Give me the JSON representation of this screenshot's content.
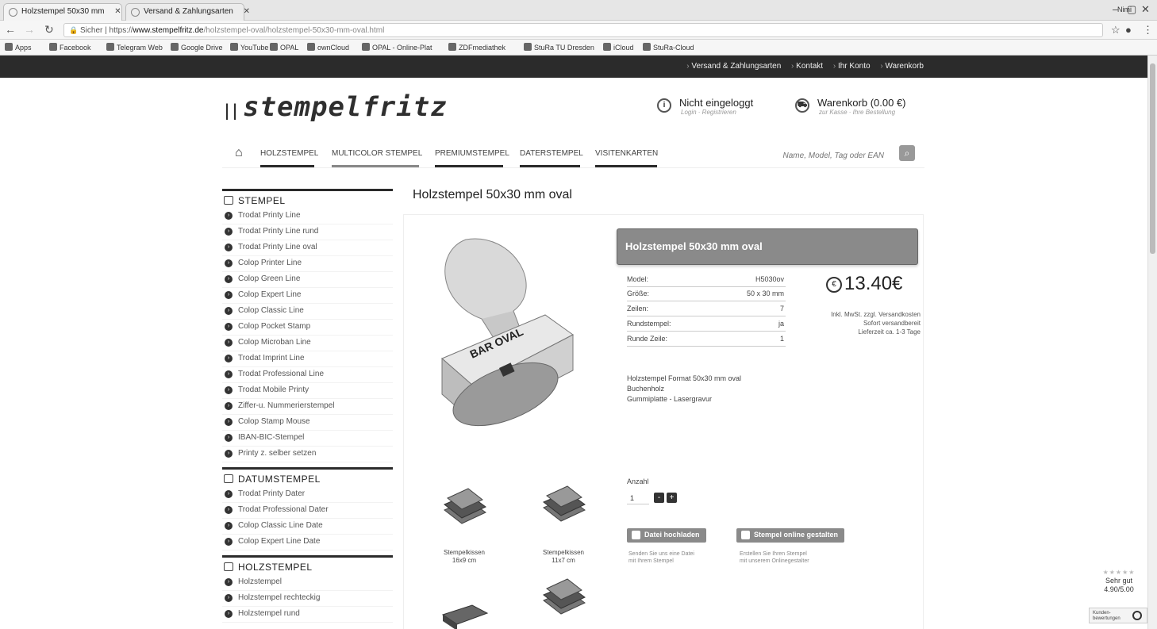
{
  "browser": {
    "tabs": [
      {
        "label": "Holzstempel 50x30 mm"
      },
      {
        "label": "Versand & Zahlungsarten"
      }
    ],
    "user_name": "Nimi",
    "url": {
      "secure_label": "Sicher",
      "scheme": "https://",
      "host": "www.stempelfritz.de",
      "path": "/holzstempel-oval/holzstempel-50x30-mm-oval.html"
    },
    "bookmarks": [
      "Apps",
      "Facebook",
      "Telegram Web",
      "Google Drive",
      "YouTube",
      "OPAL",
      "ownCloud",
      "OPAL - Online-Plat",
      "ZDFmediathek",
      "StuRa TU Dresden",
      "iCloud",
      "StuRa-Cloud"
    ]
  },
  "topbar": {
    "links": [
      "Versand & Zahlungsarten",
      "Kontakt",
      "Ihr Konto",
      "Warenkorb"
    ]
  },
  "header": {
    "logo": "stempelfritz",
    "login": {
      "title": "Nicht eingeloggt",
      "sub": "Login · Registrieren"
    },
    "cart": {
      "title": "Warenkorb (0.00 €)",
      "sub": "zur Kasse · Ihre Bestellung"
    }
  },
  "nav": {
    "items": [
      "HOLZSTEMPEL",
      "MULTICOLOR STEMPEL",
      "PREMIUMSTEMPEL",
      "DATERSTEMPEL",
      "VISITENKARTEN"
    ],
    "search_placeholder": "Name, Model, Tag oder EAN"
  },
  "sidebar": {
    "categories": [
      {
        "title": "STEMPEL",
        "items": [
          "Trodat Printy Line",
          "Trodat Printy Line rund",
          "Trodat Printy Line oval",
          "Colop Printer Line",
          "Colop Green Line",
          "Colop Expert Line",
          "Colop Classic Line",
          "Colop Pocket Stamp",
          "Colop Microban Line",
          "Trodat Imprint Line",
          "Trodat Professional Line",
          "Trodat Mobile Printy",
          "Ziffer-u. Nummerierstempel",
          "Colop Stamp Mouse",
          "IBAN-BIC-Stempel",
          "Printy z. selber setzen"
        ]
      },
      {
        "title": "DATUMSTEMPEL",
        "items": [
          "Trodat Printy Dater",
          "Trodat Professional Dater",
          "Colop Classic Line Date",
          "Colop Expert Line Date"
        ]
      },
      {
        "title": "HOLZSTEMPEL",
        "items": [
          "Holzstempel",
          "Holzstempel rechteckig",
          "Holzstempel rund"
        ]
      }
    ]
  },
  "product": {
    "title": "Holzstempel 50x30 mm oval",
    "banner": "Holzstempel 50x30 mm oval",
    "image_text": "BAR OVAL",
    "specs": [
      {
        "label": "Model:",
        "value": "H5030ov"
      },
      {
        "label": "Größe:",
        "value": "50 x 30 mm"
      },
      {
        "label": "Zeilen:",
        "value": "7"
      },
      {
        "label": "Rundstempel:",
        "value": "ja"
      },
      {
        "label": "Runde Zeile:",
        "value": "1"
      }
    ],
    "price": "13.40€",
    "price_notes": [
      "Inkl. MwSt. zzgl. Versandkosten",
      "Sofort versandbereit",
      "Lieferzeit ca. 1-3 Tage"
    ],
    "description": [
      "Holzstempel Format 50x30 mm oval",
      "Buchenholz",
      "Gummiplatte - Lasergravur"
    ],
    "quantity_label": "Anzahl",
    "quantity_value": "1",
    "buttons": [
      {
        "label": "Datei hochladen",
        "note": [
          "Senden Sie uns eine Datei",
          "mit Ihrem Stempel"
        ]
      },
      {
        "label": "Stempel online gestalten",
        "note": [
          "Erstellen Sie Ihren Stempel",
          "mit unserem Onlinegestalter"
        ]
      }
    ],
    "accessories": [
      {
        "label": [
          "Stempelkissen",
          "16x9 cm"
        ]
      },
      {
        "label": [
          "Stempelkissen",
          "11x7 cm"
        ]
      }
    ]
  },
  "rating": {
    "label": "Sehr gut",
    "score": "4.90/5.00",
    "badge": [
      "Kunden-",
      "bewertungen"
    ]
  }
}
